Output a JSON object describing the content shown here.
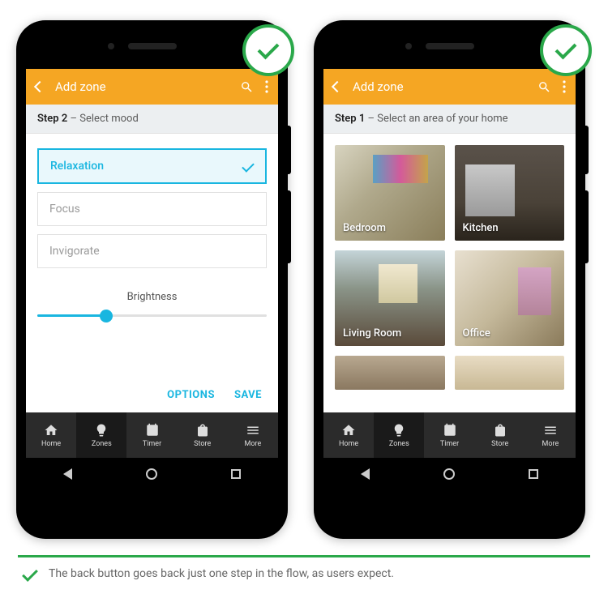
{
  "badge_status": "ok",
  "phone_left": {
    "appbar": {
      "title": "Add zone"
    },
    "step": {
      "label": "Step 2",
      "desc": "– Select mood"
    },
    "moods": [
      {
        "label": "Relaxation",
        "selected": true
      },
      {
        "label": "Focus",
        "selected": false
      },
      {
        "label": "Invigorate",
        "selected": false
      }
    ],
    "slider": {
      "label": "Brightness",
      "value_pct": 30
    },
    "actions": {
      "options": "OPTIONS",
      "save": "SAVE"
    }
  },
  "phone_right": {
    "appbar": {
      "title": "Add zone"
    },
    "step": {
      "label": "Step 1",
      "desc": "– Select an area of your home"
    },
    "areas": [
      {
        "label": "Bedroom"
      },
      {
        "label": "Kitchen"
      },
      {
        "label": "Living Room"
      },
      {
        "label": "Office"
      }
    ]
  },
  "bottomnav": {
    "items": [
      {
        "label": "Home",
        "icon": "home"
      },
      {
        "label": "Zones",
        "icon": "bulb",
        "active": true
      },
      {
        "label": "Timer",
        "icon": "timer"
      },
      {
        "label": "Store",
        "icon": "store"
      },
      {
        "label": "More",
        "icon": "more"
      }
    ]
  },
  "caption": "The back button goes back just one step in the flow, as users expect."
}
